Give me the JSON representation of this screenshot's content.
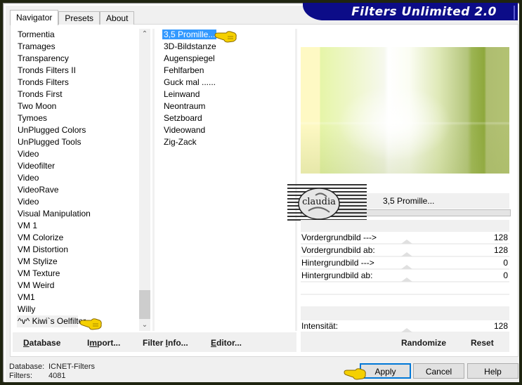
{
  "app": {
    "title": "Filters Unlimited 2.0"
  },
  "tabs": [
    {
      "label": "Navigator",
      "active": true
    },
    {
      "label": "Presets",
      "active": false
    },
    {
      "label": "About",
      "active": false
    }
  ],
  "categories": {
    "items": [
      "Tormentia",
      "Tramages",
      "Transparency",
      "Tronds Filters II",
      "Tronds Filters",
      "Tronds First",
      "Two Moon",
      "Tymoes",
      "UnPlugged Colors",
      "UnPlugged Tools",
      "Video",
      "Videofilter",
      "Video",
      "VideoRave",
      "Video",
      "Visual Manipulation",
      "VM 1",
      "VM Colorize",
      "VM Distortion",
      "VM Stylize",
      "VM Texture",
      "VM Weird",
      "VM1",
      "Willy",
      "^v^ Kiwi`s Oelfilter"
    ],
    "selected": "^v^ Kiwi`s Oelfilter"
  },
  "filters": {
    "items": [
      "3,5 Promille...",
      "3D-Bildstanze",
      "Augenspiegel",
      "Fehlfarben",
      "Guck mal ......",
      "Leinwand",
      "Neontraum",
      "Setzboard",
      "Videowand",
      "Zig-Zack"
    ],
    "selected": "3,5 Promille..."
  },
  "preview": {
    "filter_name": "3,5 Promille...",
    "logo_text": "claudia"
  },
  "parameters": [
    {
      "label": "Vordergrundbild --->",
      "value": "128"
    },
    {
      "label": "Vordergrundbild ab:",
      "value": "128"
    },
    {
      "label": "Hintergrundbild --->",
      "value": "0"
    },
    {
      "label": "Hintergrundbild ab:",
      "value": "0"
    },
    {
      "label": "",
      "value": ""
    },
    {
      "label": "",
      "value": ""
    },
    {
      "label": "Intensität:",
      "value": "128"
    }
  ],
  "toolbar": {
    "database": {
      "label": "Database",
      "mnemonic": "D",
      "rest": "atabase"
    },
    "import": {
      "label": "Import...",
      "pre": "I",
      "mnemonic": "m",
      "rest": "port..."
    },
    "filter_info": {
      "label": "Filter Info...",
      "pre": "Filter ",
      "mnemonic": "I",
      "rest": "nfo..."
    },
    "editor": {
      "label": "Editor...",
      "mnemonic": "E",
      "rest": "ditor..."
    },
    "randomize": "Randomize",
    "reset": "Reset"
  },
  "status": {
    "database_label": "Database:",
    "database_value": "ICNET-Filters",
    "filters_label": "Filters:",
    "filters_value": "4081"
  },
  "buttons": {
    "apply": "Apply",
    "cancel": "Cancel",
    "help": "Help"
  },
  "colors": {
    "banner": "#0c0c88",
    "selection": "#3399ff",
    "default_button_border": "#0078d7"
  }
}
